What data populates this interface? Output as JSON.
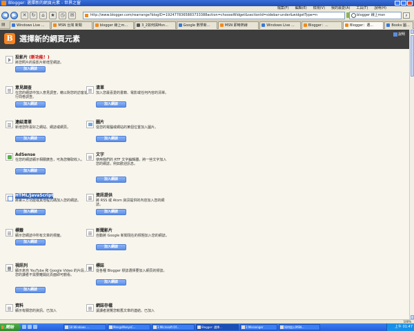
{
  "window": {
    "title": "Blogger: 選擇新的網頁元素 - 世界之窗"
  },
  "menu": [
    "檔案(F)",
    "編輯(E)",
    "檢視(V)",
    "我的最愛(A)",
    "工具(T)",
    "說明(H)"
  ],
  "nav": {
    "url": "http://www.blogger.com/rearrange?blogID=1924778365883733388action=chooseWidget&sectionId=sidebar-under&widgetType=n",
    "search_value": "blogger 線上msn"
  },
  "tabs": [
    {
      "label": "Windows Live ...",
      "color": "#3a78d6"
    },
    {
      "label": "MSN 台灣 新聞",
      "color": "#f08a1c"
    },
    {
      "label": "blogger 線上m...",
      "color": "#f08a1c"
    },
    {
      "label": "3_2如何與Msn...",
      "color": "#555555"
    },
    {
      "label": "Google 數學新...",
      "color": "#3a78d6"
    },
    {
      "label": "MSN 即時熱線",
      "color": "#f08a1c"
    },
    {
      "label": "Windows Live ...",
      "color": "#3a78d6"
    },
    {
      "label": "Blogger：...",
      "color": "#f08a1c"
    },
    {
      "label": "Blogger：選...",
      "color": "#f08a1c"
    },
    {
      "label": "Books 圖...",
      "color": "#3a78d6"
    }
  ],
  "page": {
    "title": "選擇新的網頁元素",
    "help": "說明",
    "add_label": "加入網誌"
  },
  "widgets": [
    {
      "id": "video",
      "name": "投影片",
      "badge": "(新功能！)",
      "desc": "將您照片的投影片新增至網誌。"
    },
    {
      "id": "poll",
      "name": "意見調查",
      "desc": "在您的網誌中加入意見調查，藉以對您的訪客進行問卷調查。"
    },
    {
      "id": "list",
      "name": "清單",
      "desc": "加入您最喜愛的書籍、電影或任何內容的清單。"
    },
    {
      "id": "links",
      "name": "連結清單",
      "desc": "新增您所喜好之網站、網誌或網頁。"
    },
    {
      "id": "image",
      "name": "圖片",
      "desc": "從您的電腦或網站的某個位置加入圖片。"
    },
    {
      "id": "adsense",
      "name": "AdSense",
      "desc": "在您的網誌顯示相關廣告，可為您賺取收入。"
    },
    {
      "id": "text",
      "name": "文字",
      "desc": "使用我們的 RTF 文字編輯器，將一些文字加入您的網誌，例如歡迎訊息。"
    },
    {
      "id": "html",
      "name": "HTML/JavaScript",
      "desc": "將第三方功能或其他程式碼加入您的網誌。"
    },
    {
      "id": "feed",
      "name": "資訊提供",
      "desc": "將 RSS 或 Atom 資訊提供的內容加入您的網誌。"
    },
    {
      "id": "labels",
      "name": "標籤",
      "desc": "顯示您網誌中所有文章的標籤。"
    },
    {
      "id": "newsreel",
      "name": "新聞影片",
      "desc": "自動將 Google 新聞現在的標題加入您的網誌。"
    },
    {
      "id": "videobar",
      "name": "視訊列",
      "desc": "顯示來自 YouTube 和 Google Video 的片段，您的讀者不需要離開此頁面即可觀看。"
    },
    {
      "id": "logo",
      "name": "標誌",
      "desc": "從各種 Blogger 標誌選擇要加入網頁的標誌。"
    },
    {
      "id": "profile",
      "name": "資料",
      "desc": "顯示有關您的資訊。已加入"
    },
    {
      "id": "archive",
      "name": "網誌存檔",
      "desc": "讓讀者瀏覽您較舊文章的連結。已加入"
    }
  ],
  "statusbar": {
    "zoom": "100%"
  },
  "taskbar": {
    "start": "開始",
    "tasks": [
      "18 Windows ...",
      "MengsMeeysC...",
      "3 Microsoft Of...",
      "Blogger: 選擇...",
      "3 Messenger",
      "如何加入MSN..."
    ],
    "clock": "上午 01:47"
  }
}
